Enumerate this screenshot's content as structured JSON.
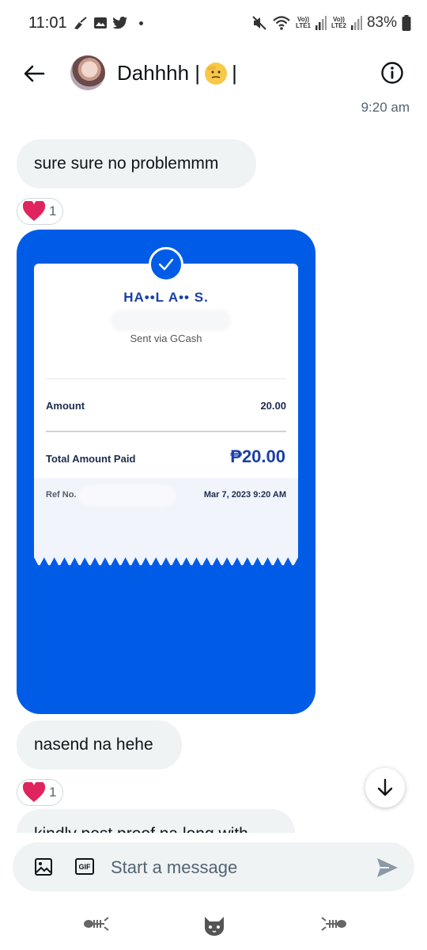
{
  "status_bar": {
    "time": "11:01",
    "battery": "83%",
    "lte1": "LTE1",
    "lte2": "LTE2",
    "volte": "Vo))"
  },
  "header": {
    "contact_name": "Dahhhh |",
    "name_suffix": "|",
    "back_icon": "arrow-left-icon",
    "info_icon": "info-icon",
    "time": "9:20 am"
  },
  "messages": [
    {
      "text": "sure sure no problemmm",
      "reaction": {
        "emoji": "heart",
        "count": "1"
      }
    },
    {
      "type": "image",
      "image_desc": "GCash receipt"
    },
    {
      "text": "nasend na hehe",
      "reaction": {
        "emoji": "heart",
        "count": "1"
      }
    },
    {
      "text": "kindly post proof na long with"
    }
  ],
  "receipt": {
    "recipient": "HA••L A•• S.",
    "via": "Sent via GCash",
    "amount_label": "Amount",
    "amount_value": "20.00",
    "total_label": "Total Amount Paid",
    "total_value": "₱20.00",
    "ref_label": "Ref No.",
    "date": "Mar 7, 2023 9:20 AM"
  },
  "composer": {
    "placeholder": "Start a message",
    "gif_label": "GIF"
  },
  "colors": {
    "gcash_blue": "#005ce6",
    "bubble_bg": "#eff3f4",
    "heart": "#e0245e"
  }
}
